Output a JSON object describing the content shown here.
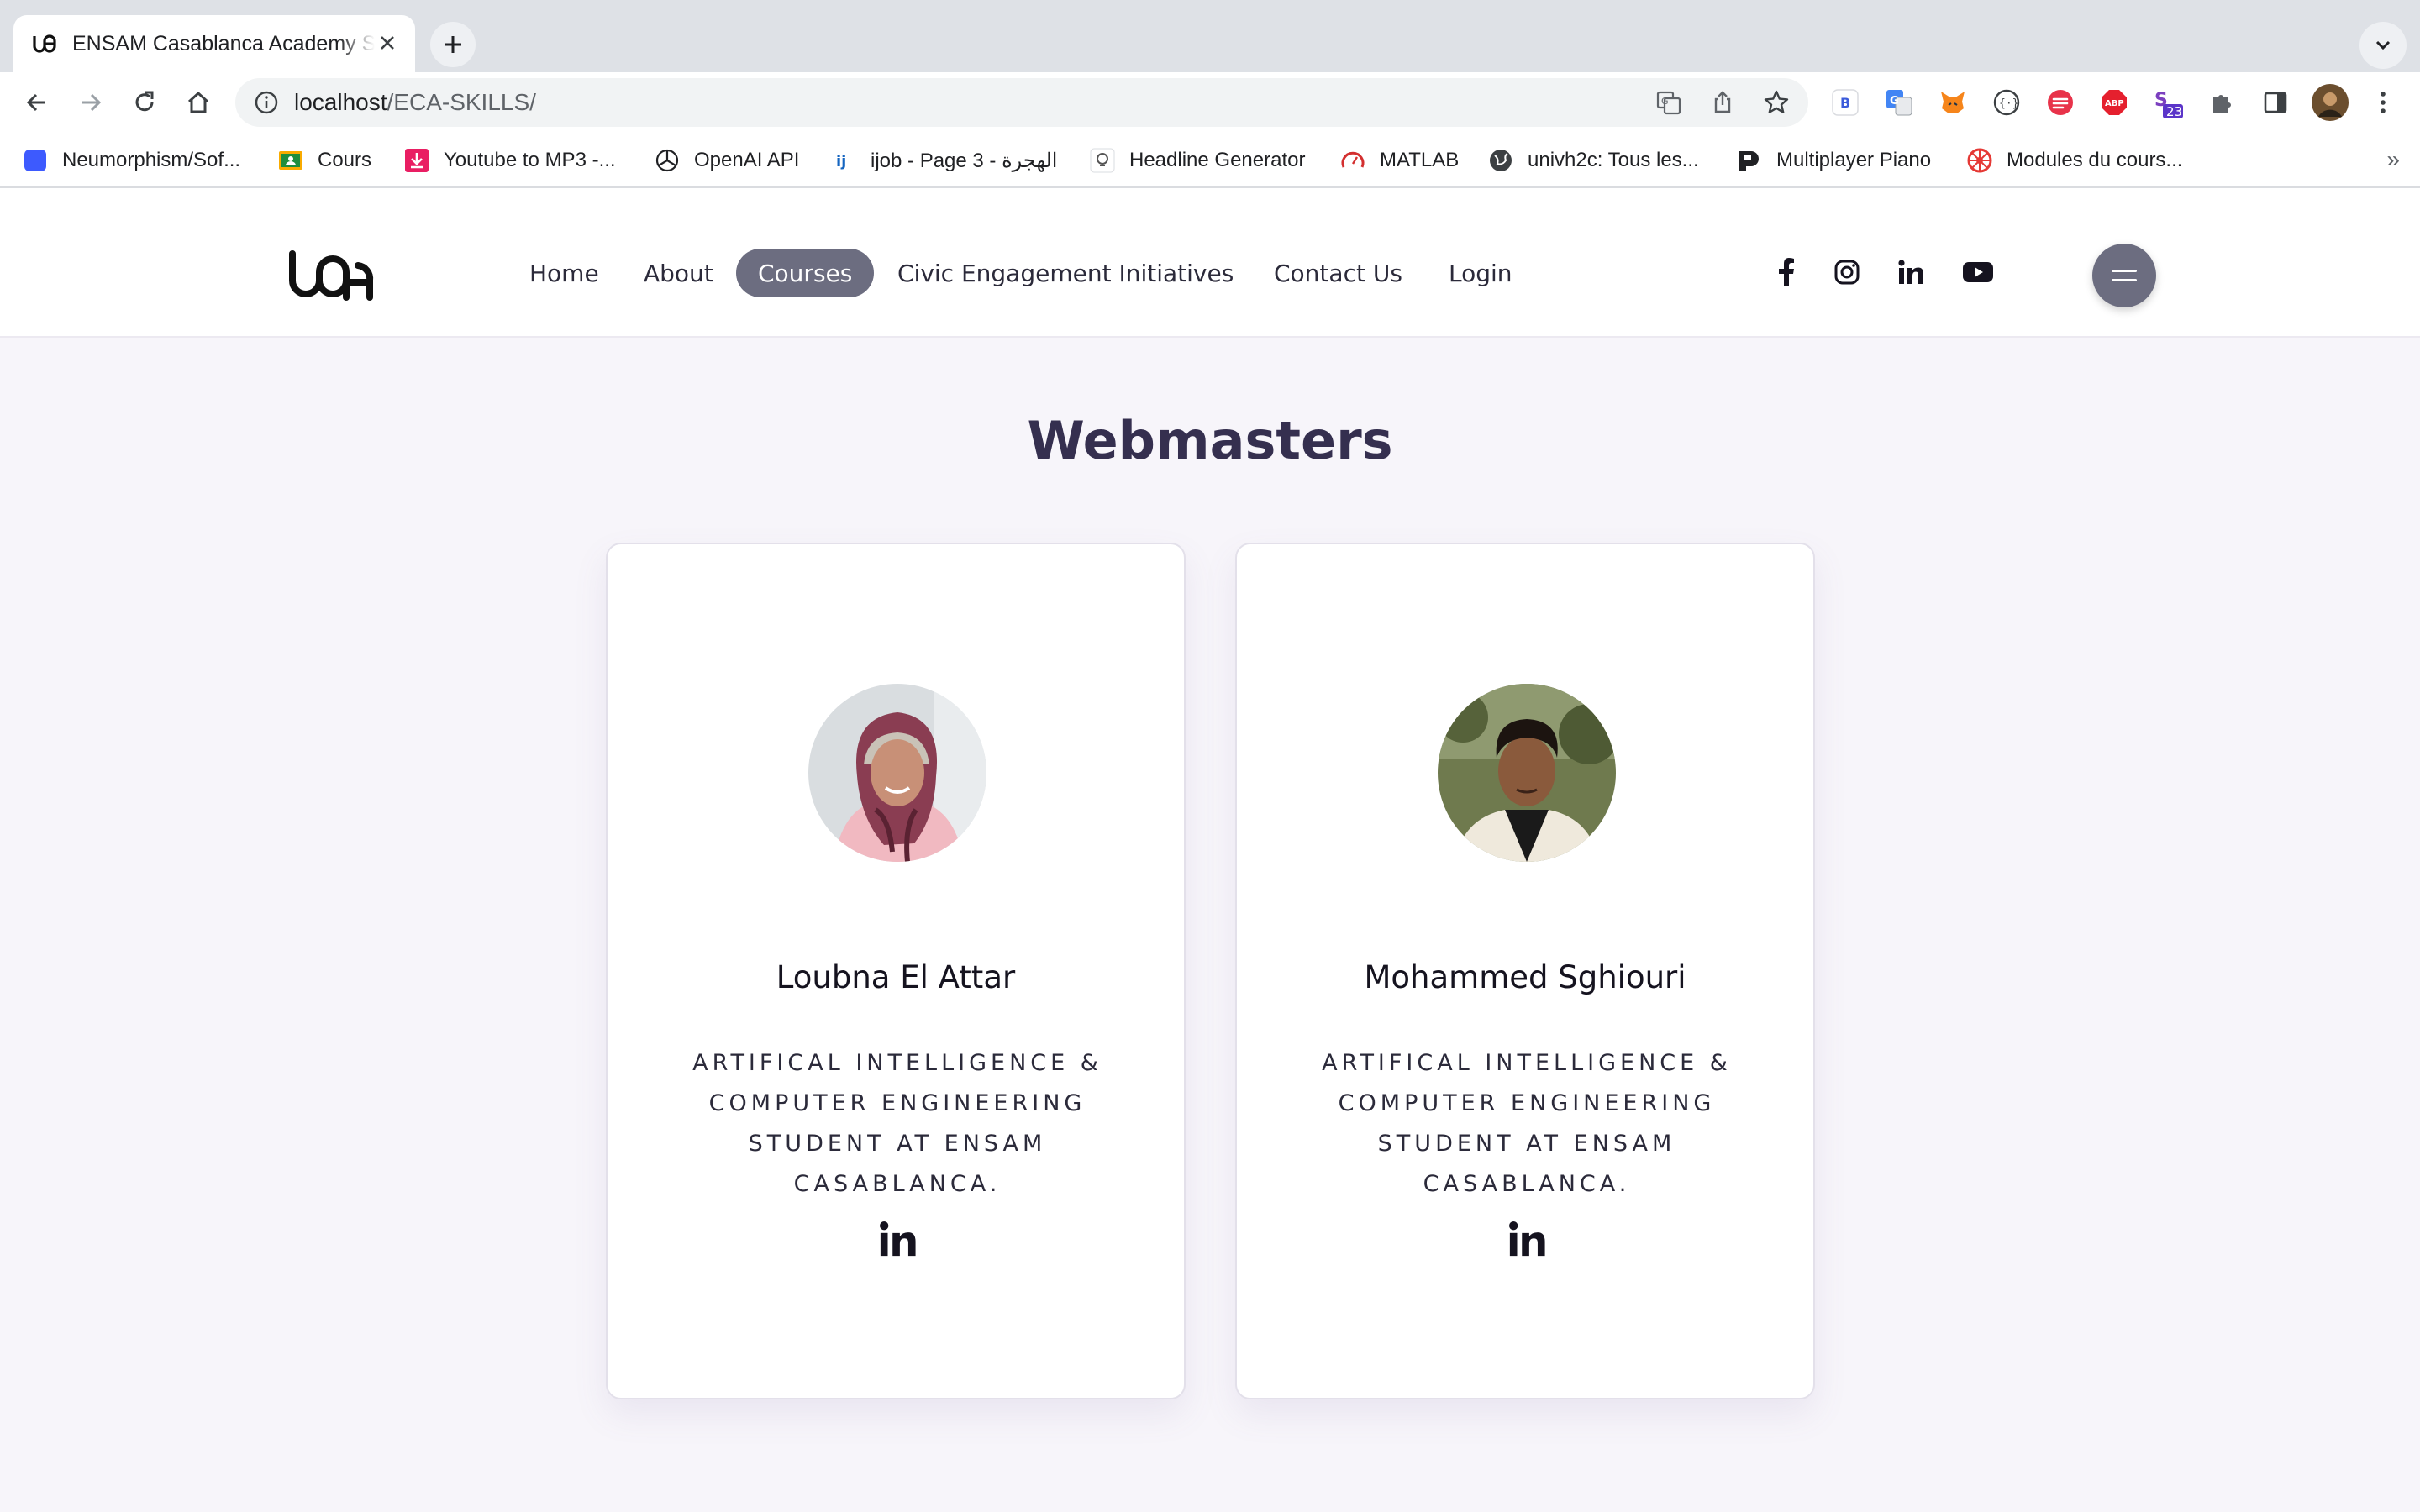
{
  "browser": {
    "tab_title": "ENSAM Casablanca Academy Skills",
    "url_host": "localhost",
    "url_path": "/ECA-SKILLS/",
    "extension_badge": "23",
    "bookmarks": [
      {
        "label": "Neumorphism/Sof...",
        "icon": "square-icon"
      },
      {
        "label": "Cours",
        "icon": "classroom-icon"
      },
      {
        "label": "Youtube to MP3 -...",
        "icon": "download-icon"
      },
      {
        "label": "OpenAI API",
        "icon": "openai-icon"
      },
      {
        "label": "ijob - Page 3 - الهجرة",
        "icon": "ijob-icon"
      },
      {
        "label": "Headline Generator",
        "icon": "bulb-icon"
      },
      {
        "label": "MATLAB",
        "icon": "gauge-icon"
      },
      {
        "label": "univh2c: Tous les...",
        "icon": "globe-icon"
      },
      {
        "label": "Multiplayer Piano",
        "icon": "piano-icon"
      },
      {
        "label": "Modules du cours...",
        "icon": "wheel-icon"
      }
    ],
    "more_bookmarks": "»"
  },
  "site": {
    "nav": {
      "home": "Home",
      "about": "About",
      "courses": "Courses",
      "civic": "Civic Engagement Initiatives",
      "contact": "Contact Us",
      "login": "Login"
    },
    "social_icons": [
      "facebook-icon",
      "instagram-icon",
      "linkedin-icon",
      "youtube-icon"
    ],
    "accent_color": "#6c6d80"
  },
  "main": {
    "title": "Webmasters",
    "cards": [
      {
        "name": "Loubna El Attar",
        "role": "ARTIFICAL INTELLIGENCE & COMPUTER ENGINEERING STUDENT AT ENSAM CASABLANCA."
      },
      {
        "name": "Mohammed Sghiouri",
        "role": "ARTIFICAL INTELLIGENCE & COMPUTER ENGINEERING STUDENT AT ENSAM CASABLANCA."
      }
    ]
  }
}
